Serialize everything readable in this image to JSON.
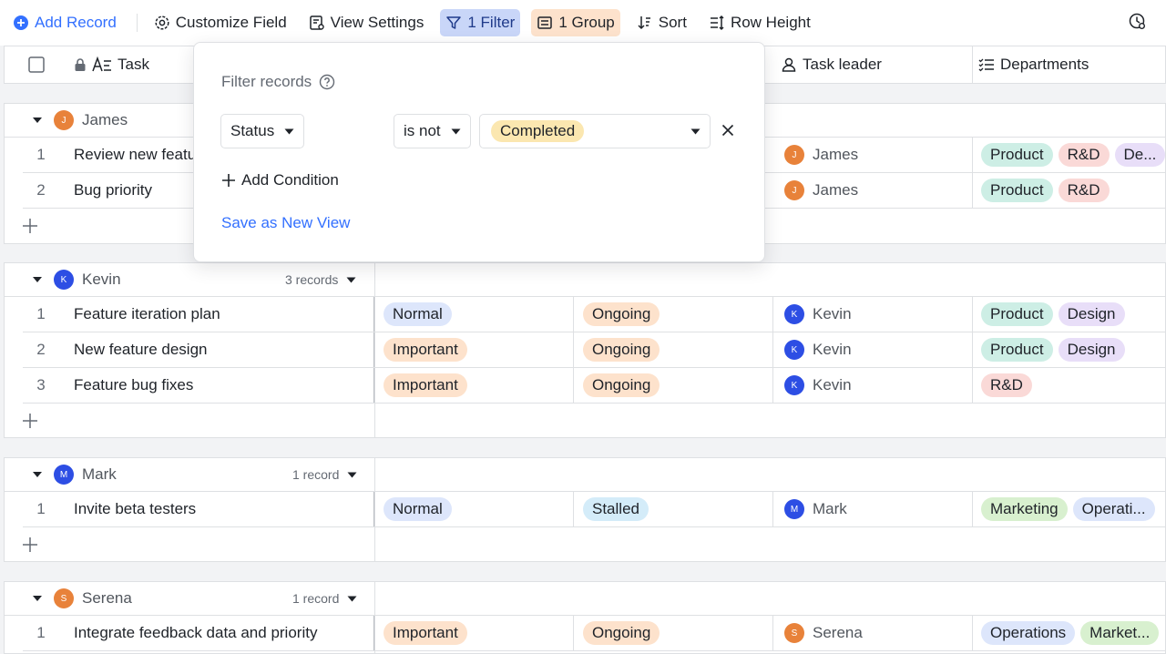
{
  "toolbar": {
    "add_record": "Add Record",
    "customize_field": "Customize Field",
    "view_settings": "View Settings",
    "filter": "1 Filter",
    "group": "1 Group",
    "sort": "Sort",
    "row_height": "Row Height"
  },
  "columns": {
    "task": "Task",
    "task_leader": "Task leader",
    "departments": "Departments"
  },
  "filter_popup": {
    "title": "Filter records",
    "field": "Status",
    "operator": "is not",
    "value": "Completed",
    "add_condition": "Add Condition",
    "save_view": "Save as New View"
  },
  "groups": [
    {
      "name": "James",
      "initial": "J",
      "color": "orange",
      "count": "",
      "rows": [
        {
          "num": "1",
          "task": "Review new featu",
          "priority": "",
          "status": "",
          "leader": "James",
          "depts": [
            "Product",
            "R&D",
            "De..."
          ]
        },
        {
          "num": "2",
          "task": "Bug priority",
          "priority": "",
          "status": "",
          "leader": "James",
          "depts": [
            "Product",
            "R&D"
          ]
        }
      ]
    },
    {
      "name": "Kevin",
      "initial": "K",
      "color": "blue",
      "count": "3 records",
      "rows": [
        {
          "num": "1",
          "task": "Feature iteration plan",
          "priority": "Normal",
          "status": "Ongoing",
          "leader": "Kevin",
          "depts": [
            "Product",
            "Design"
          ]
        },
        {
          "num": "2",
          "task": "New feature design",
          "priority": "Important",
          "status": "Ongoing",
          "leader": "Kevin",
          "depts": [
            "Product",
            "Design"
          ]
        },
        {
          "num": "3",
          "task": "Feature bug fixes",
          "priority": "Important",
          "status": "Ongoing",
          "leader": "Kevin",
          "depts": [
            "R&D"
          ]
        }
      ]
    },
    {
      "name": "Mark",
      "initial": "M",
      "color": "blue",
      "count": "1 record",
      "rows": [
        {
          "num": "1",
          "task": "Invite beta testers",
          "priority": "Normal",
          "status": "Stalled",
          "leader": "Mark",
          "depts": [
            "Marketing",
            "Operati..."
          ]
        }
      ]
    },
    {
      "name": "Serena",
      "initial": "S",
      "color": "orange",
      "count": "1 record",
      "rows": [
        {
          "num": "1",
          "task": "Integrate feedback data and priority",
          "priority": "Important",
          "status": "Ongoing",
          "leader": "Serena",
          "depts": [
            "Operations",
            "Market..."
          ]
        }
      ]
    }
  ],
  "tag_colors": {
    "Normal": "#dde6fb",
    "Important": "#fde2cc",
    "Ongoing": "#fde2cc",
    "Stalled": "#d4ecf9",
    "Completed": "#fbe7b0",
    "Product": "#cdeee5",
    "R&D": "#fad9d7",
    "De...": "#e8def8",
    "Design": "#e8def8",
    "Marketing": "#d8f0cf",
    "Operati...": "#dde6fb",
    "Operations": "#dde6fb",
    "Market...": "#d8f0cf"
  }
}
